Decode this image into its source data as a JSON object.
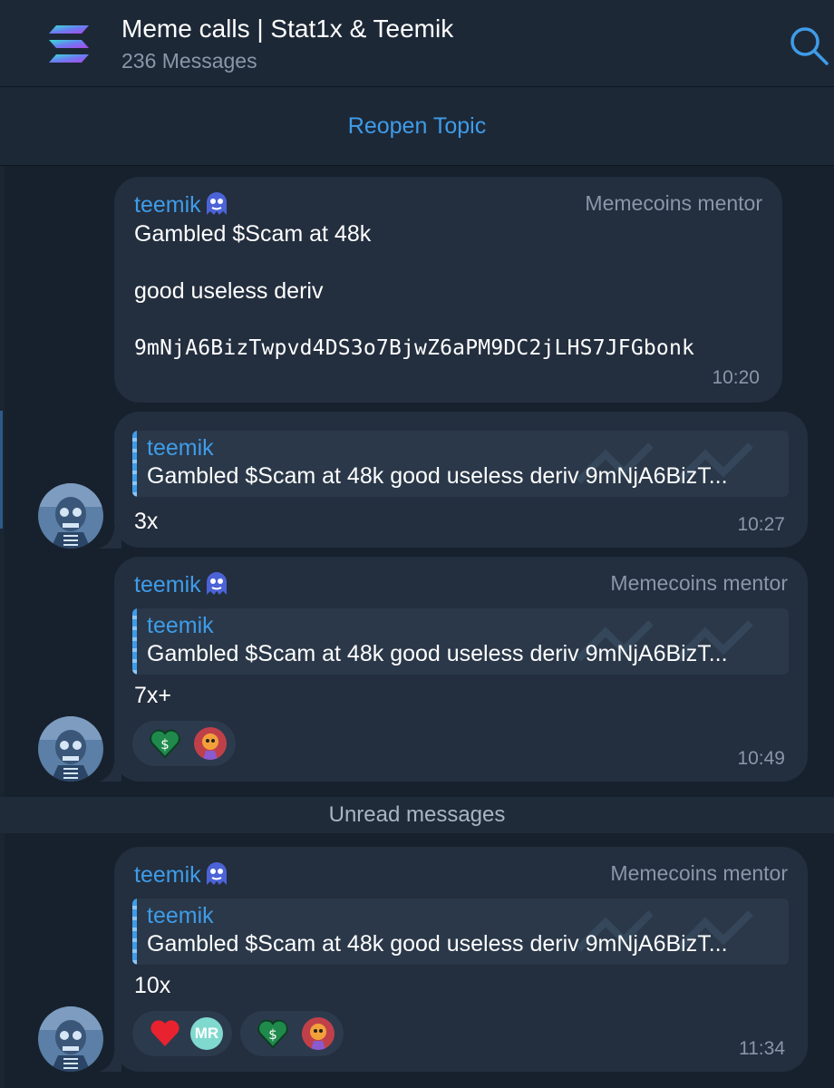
{
  "header": {
    "title": "Meme calls | Stat1x & Teemik",
    "subtitle": "236 Messages",
    "logo_icon": "solana-logo-icon",
    "search_icon": "search-icon"
  },
  "reopen": {
    "label": "Reopen Topic"
  },
  "colors": {
    "accent": "#3f9ce8",
    "bubble": "#232e3e",
    "background": "#17212d",
    "muted": "#8a97a8"
  },
  "messages": [
    {
      "name": "teemik",
      "role": "Memecoins mentor",
      "lines": [
        "Gambled $Scam at 48k",
        "good useless deriv",
        "9mNjA6BizTwpvd4DS3o7BjwZ6aPM9DC2jLHS7JFGbonk"
      ],
      "time": "10:20"
    },
    {
      "reply": {
        "name": "teemik",
        "text": "Gambled $Scam at 48k  good useless deriv  9mNjA6BizT..."
      },
      "text": "3x",
      "time": "10:27"
    },
    {
      "name": "teemik",
      "role": "Memecoins mentor",
      "reply": {
        "name": "teemik",
        "text": "Gambled $Scam at 48k  good useless deriv  9mNjA6BizT..."
      },
      "text": "7x+",
      "reactions": [
        {
          "emoji": "green-dollar-heart-icon",
          "users": [
            "pixel-avatar"
          ]
        }
      ],
      "time": "10:49"
    },
    {
      "name": "teemik",
      "role": "Memecoins mentor",
      "reply": {
        "name": "teemik",
        "text": "Gambled $Scam at 48k  good useless deriv  9mNjA6BizT..."
      },
      "text": "10x",
      "reactions": [
        {
          "emoji": "red-heart-icon",
          "users": [
            "MR"
          ]
        },
        {
          "emoji": "green-dollar-heart-icon",
          "users": [
            "pixel-avatar"
          ]
        }
      ],
      "time": "11:34"
    }
  ],
  "unread_divider": "Unread messages"
}
